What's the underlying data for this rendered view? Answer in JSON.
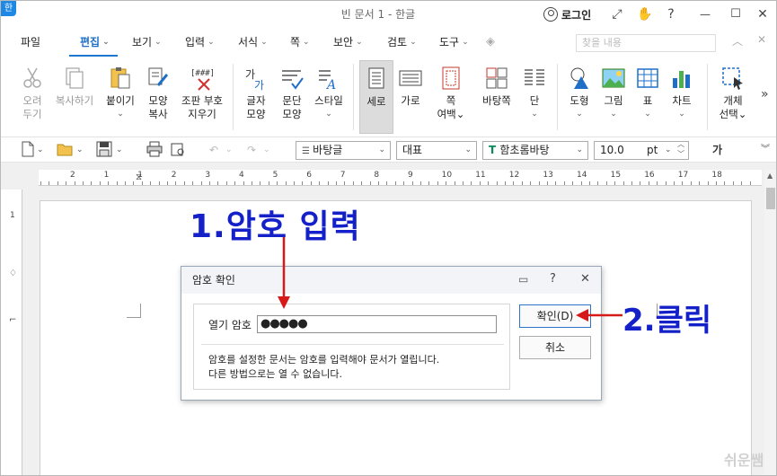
{
  "window": {
    "app_icon": "한",
    "title": "빈 문서 1 - 한글",
    "login": "로그인",
    "controls": [
      "⤢",
      "✋",
      "?",
      "—",
      "☐",
      "✕"
    ]
  },
  "menu": {
    "items": [
      "파일",
      "편집",
      "보기",
      "입력",
      "서식",
      "쪽",
      "보안",
      "검토",
      "도구"
    ],
    "active": "편집",
    "search_placeholder": "찾을 내용"
  },
  "ribbon": {
    "buttons": [
      {
        "l1": "오려",
        "l2": "두기"
      },
      {
        "l1": "복사하기",
        "l2": ""
      },
      {
        "l1": "붙이기",
        "l2": "⌄"
      },
      {
        "l1": "모양",
        "l2": "복사"
      },
      {
        "l1": "조판 부호",
        "l2": "지우기"
      },
      {
        "l1": "글자",
        "l2": "모양"
      },
      {
        "l1": "문단",
        "l2": "모양"
      },
      {
        "l1": "스타일",
        "l2": "⌄"
      },
      {
        "l1": "세로",
        "l2": ""
      },
      {
        "l1": "가로",
        "l2": ""
      },
      {
        "l1": "쪽",
        "l2": "여백⌄"
      },
      {
        "l1": "바탕쪽",
        "l2": ""
      },
      {
        "l1": "단",
        "l2": "⌄"
      },
      {
        "l1": "도형",
        "l2": "⌄"
      },
      {
        "l1": "그림",
        "l2": "⌄"
      },
      {
        "l1": "표",
        "l2": "⌄"
      },
      {
        "l1": "차트",
        "l2": "⌄"
      },
      {
        "l1": "개체",
        "l2": "선택⌄"
      }
    ],
    "more": "»"
  },
  "toolbar2": {
    "style_combo": "바탕글",
    "lang_combo": "대표",
    "font_combo": "함초롬바탕",
    "size_value": "10.0",
    "size_unit": "pt",
    "char_button": "가"
  },
  "ruler": {
    "h_numbers": [
      "2",
      "1",
      "1",
      "2",
      "3",
      "4",
      "5",
      "6",
      "7",
      "8",
      "9",
      "10",
      "11",
      "12",
      "13",
      "14",
      "15",
      "16",
      "17",
      "18"
    ]
  },
  "watermark": "쉬운쌤",
  "dialog": {
    "title": "암호 확인",
    "field_label": "열기 암호",
    "field_value": "●●●●●",
    "note_line1": "암호를 설정한 문서는 암호를 입력해야 문서가 열립니다.",
    "note_line2": "다른 방법으로는 열 수 없습니다.",
    "ok_label": "확인(D)",
    "cancel_label": "취소"
  },
  "annotations": {
    "step1": "1.암호 입력",
    "step2": "2.클릭"
  }
}
